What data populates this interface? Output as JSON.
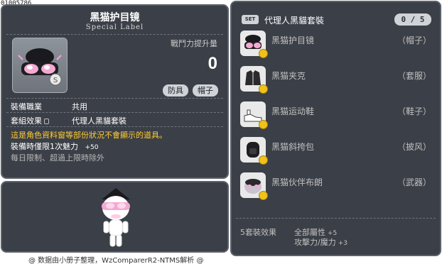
{
  "item_id": "01005786",
  "item": {
    "name": "黑猫护目镜",
    "label": "Special Label",
    "stat_label": "戰鬥力提升量",
    "stat_value": "0",
    "tags": [
      "防具",
      "帽子"
    ],
    "job_label": "裝備職業",
    "job_value": "共用",
    "set_label": "套組效果",
    "set_value": "代理人黑貓套裝",
    "desc_warning": "這是角色資料窗等部份狀況不會顯示的道具。",
    "charm_label": "裝備時僅限1次魅力",
    "charm_value": "+50",
    "limit_text": "每日限制、超過上限時除外"
  },
  "set": {
    "badge": "SET",
    "name": "代理人黑貓套裝",
    "count": "0 / 5",
    "items": [
      {
        "name": "黑猫护目镜",
        "slot": "（帽子）",
        "icon": "goggles-icon"
      },
      {
        "name": "黑猫夹克",
        "slot": "（套服）",
        "icon": "jacket-icon"
      },
      {
        "name": "黑猫运动鞋",
        "slot": "（鞋子）",
        "icon": "sneakers-icon"
      },
      {
        "name": "黑猫斜挎包",
        "slot": "（披风）",
        "icon": "backpack-icon"
      },
      {
        "name": "黑猫伙伴布朗",
        "slot": "（武器）",
        "icon": "companion-icon"
      }
    ],
    "bonus_label": "5套裝效果",
    "bonuses": [
      {
        "text": "全部屬性",
        "value": "+5"
      },
      {
        "text": "攻擊力/魔力",
        "value": "+3"
      }
    ]
  },
  "footer": "@ 数据由小册子整理，WzComparerR2-NTMS解析 @",
  "colors": {
    "panel_bg": "#3b3f47",
    "warning": "#ffcc33",
    "coin": "#f1c21a"
  }
}
